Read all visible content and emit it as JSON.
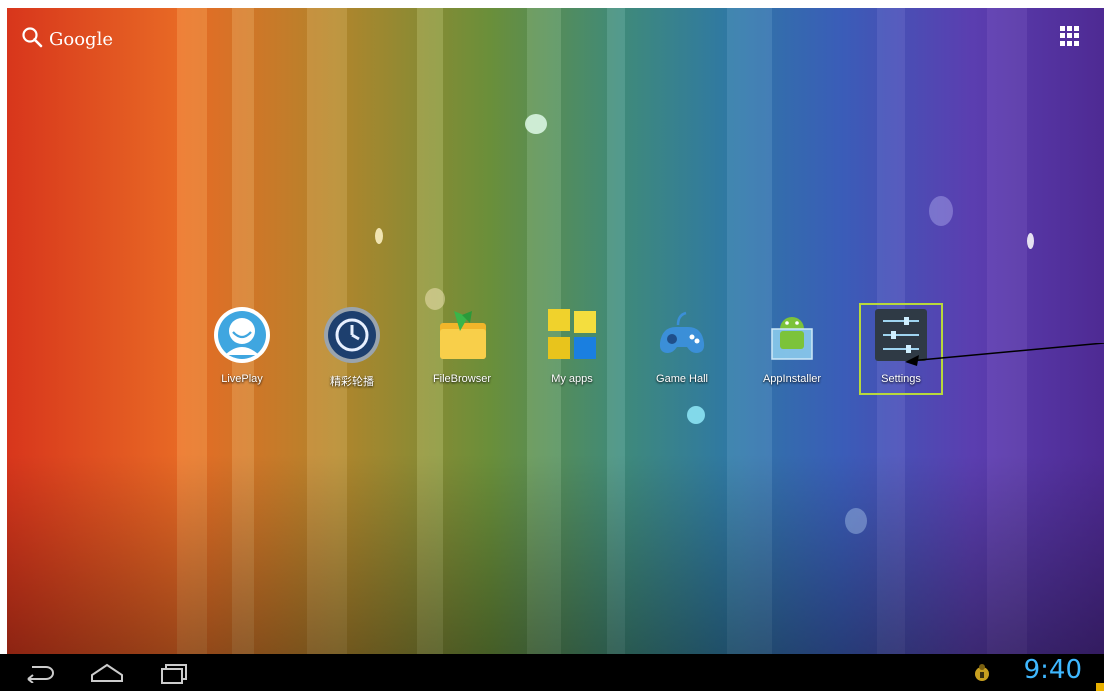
{
  "search": {
    "label": "Google",
    "icon": "search-icon"
  },
  "apps_drawer": {
    "icon": "apps-grid-icon"
  },
  "apps": [
    {
      "label": "LivePlay",
      "icon": "liveplay-icon"
    },
    {
      "label": "精彩轮播",
      "icon": "clock-replay-icon"
    },
    {
      "label": "FileBrowser",
      "icon": "folder-icon"
    },
    {
      "label": "My apps",
      "icon": "tiles-icon"
    },
    {
      "label": "Game Hall",
      "icon": "gamepad-icon"
    },
    {
      "label": "AppInstaller",
      "icon": "android-box-icon"
    },
    {
      "label": "Settings",
      "icon": "settings-sliders-icon"
    }
  ],
  "statusbar": {
    "time": "9:40"
  },
  "colors": {
    "accent": "#3fb8ff",
    "selection": "#b8d83c"
  }
}
